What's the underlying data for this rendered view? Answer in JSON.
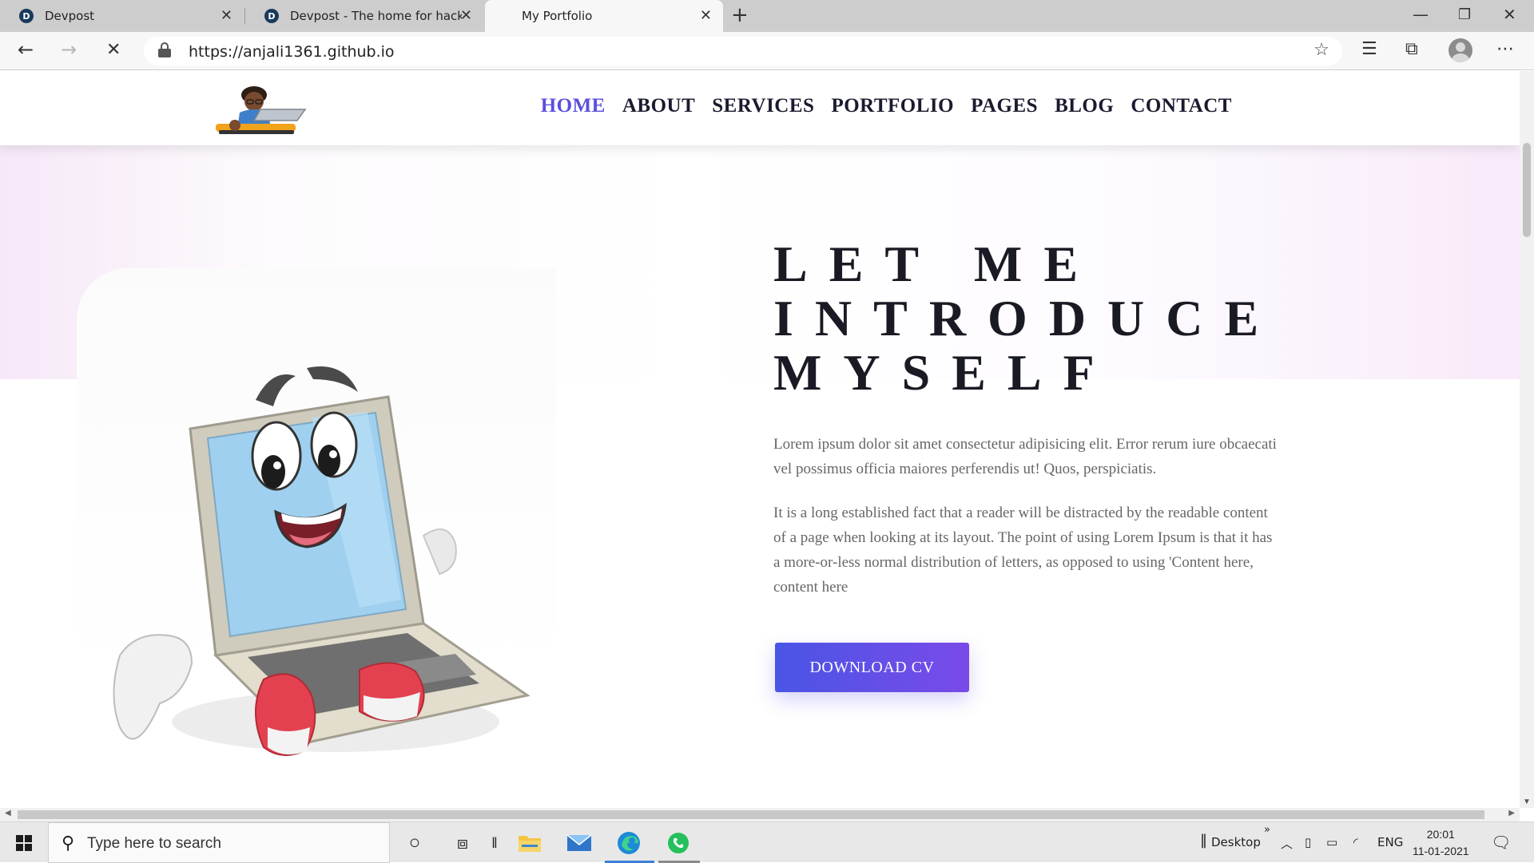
{
  "browser": {
    "tabs": [
      {
        "title": "Devpost",
        "favicon": "D"
      },
      {
        "title": "Devpost - The home for hackath",
        "favicon": "D"
      },
      {
        "title": "My Portfolio"
      }
    ],
    "address": "https://anjali1361.github.io"
  },
  "site": {
    "nav": [
      "HOME",
      "ABOUT",
      "SERVICES",
      "PORTFOLIO",
      "PAGES",
      "BLOG",
      "CONTACT"
    ],
    "active_nav": "HOME",
    "hero": {
      "title_lines": [
        "LET ME",
        "INTRODUCE",
        "MYSELF"
      ],
      "para1": "Lorem ipsum dolor sit amet consectetur adipisicing elit. Error rerum iure obcaecati vel possimus officia maiores perferendis ut! Quos, perspiciatis.",
      "para2": "It is a long established fact that a reader will be distracted by the readable content of a page when looking at its layout. The point of using Lorem Ipsum is that it has a more-or-less normal distribution of letters, as opposed to using 'Content here, content here",
      "cta": "DOWNLOAD CV"
    },
    "colors": {
      "accent": "#5b4fe0",
      "cta_start": "#4a55e6",
      "cta_end": "#7a4ae8"
    }
  },
  "taskbar": {
    "search_placeholder": "Type here to search",
    "desktop_label": "Desktop",
    "language": "ENG",
    "time": "20:01",
    "date": "11-01-2021"
  }
}
